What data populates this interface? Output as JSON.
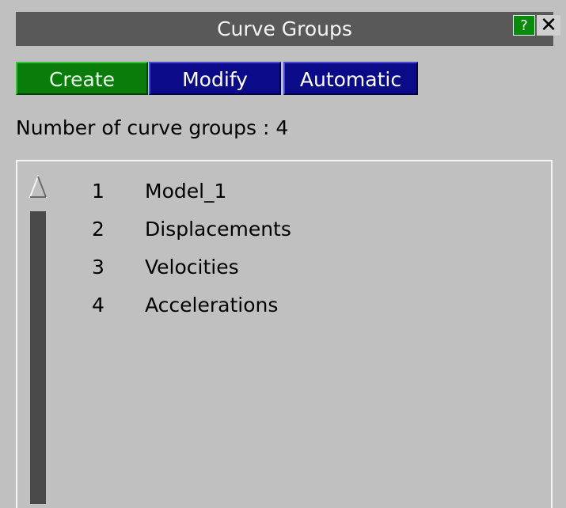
{
  "window": {
    "title": "Curve Groups",
    "help_label": "?",
    "close_label": "✕"
  },
  "tabs": [
    {
      "label": "Create"
    },
    {
      "label": "Modify"
    },
    {
      "label": "Automatic"
    }
  ],
  "summary": {
    "text": "Number of curve groups : 4"
  },
  "groups": [
    {
      "number": "1",
      "name": "Model_1"
    },
    {
      "number": "2",
      "name": "Displacements"
    },
    {
      "number": "3",
      "name": "Velocities"
    },
    {
      "number": "4",
      "name": "Accelerations"
    }
  ],
  "icons": {
    "scroll_up": "triangle-up-icon"
  },
  "colors": {
    "background": "#c0c0c0",
    "title_bar": "#595959",
    "create_tab": "#0a7c0a",
    "modify_tab": "#0b0b8a",
    "automatic_tab": "#0b0b8a",
    "help_button": "#0a8a0a",
    "scroll_track": "#4a4a4a"
  }
}
